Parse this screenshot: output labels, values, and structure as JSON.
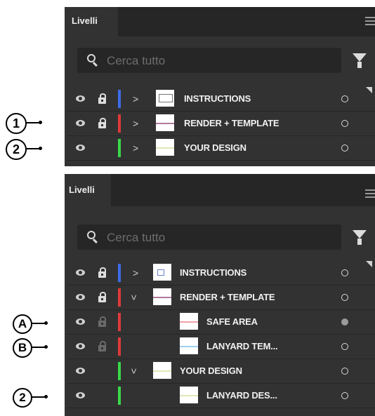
{
  "panel_top": {
    "tab_label": "Livelli",
    "search_placeholder": "Cerca tutto",
    "layers": [
      {
        "label": "INSTRUCTIONS",
        "color": "#3d6ce8",
        "locked": true,
        "expanded": false
      },
      {
        "label": "RENDER + TEMPLATE",
        "color": "#e03a3a",
        "locked": true,
        "expanded": false
      },
      {
        "label": "YOUR DESIGN",
        "color": "#3ad84a",
        "locked": false,
        "expanded": false
      }
    ]
  },
  "panel_bottom": {
    "tab_label": "Livelli",
    "search_placeholder": "Cerca tutto",
    "layers": [
      {
        "label": "INSTRUCTIONS",
        "color": "#3d6ce8",
        "locked": true,
        "expanded": false
      },
      {
        "label": "RENDER + TEMPLATE",
        "color": "#e03a3a",
        "locked": true,
        "expanded": true
      },
      {
        "label": "SAFE AREA",
        "color": "#e03a3a",
        "locked": true,
        "sublayer": true,
        "target_selected": true
      },
      {
        "label": "LANYARD TEM...",
        "color": "#e03a3a",
        "locked": true,
        "sublayer": true
      },
      {
        "label": "YOUR DESIGN",
        "color": "#3ad84a",
        "locked": false,
        "expanded": true
      },
      {
        "label": "LANYARD DES...",
        "color": "#3ad84a",
        "locked": false,
        "sublayer": true
      }
    ]
  },
  "callouts": [
    "1",
    "2",
    "A",
    "B",
    "2"
  ],
  "icons": [
    "eye-icon",
    "lock-icon",
    "chevron-icon",
    "search-icon",
    "filter-icon",
    "panel-menu-icon",
    "target-circle-icon"
  ]
}
